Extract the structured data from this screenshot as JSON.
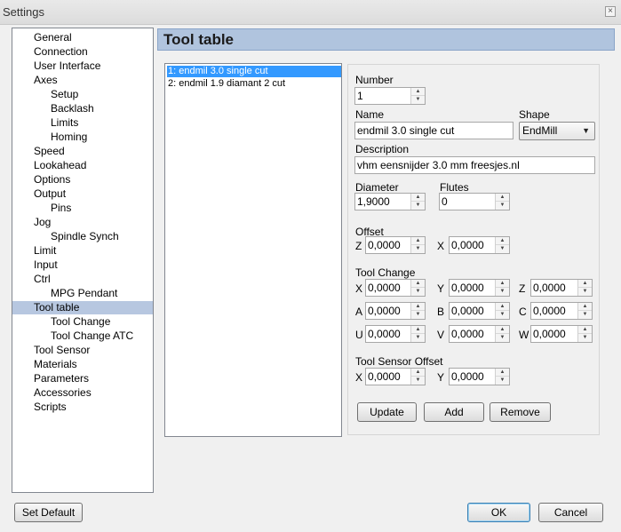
{
  "window": {
    "title": "Settings",
    "close_glyph": "×",
    "close_icon": "close-icon"
  },
  "nav": {
    "items": [
      {
        "label": "General",
        "level": 0,
        "selected": false
      },
      {
        "label": "Connection",
        "level": 0,
        "selected": false
      },
      {
        "label": "User Interface",
        "level": 0,
        "selected": false
      },
      {
        "label": "Axes",
        "level": 0,
        "selected": false
      },
      {
        "label": "Setup",
        "level": 1,
        "selected": false
      },
      {
        "label": "Backlash",
        "level": 1,
        "selected": false
      },
      {
        "label": "Limits",
        "level": 1,
        "selected": false
      },
      {
        "label": "Homing",
        "level": 1,
        "selected": false
      },
      {
        "label": "Speed",
        "level": 0,
        "selected": false
      },
      {
        "label": "Lookahead",
        "level": 0,
        "selected": false
      },
      {
        "label": "Options",
        "level": 0,
        "selected": false
      },
      {
        "label": "Output",
        "level": 0,
        "selected": false
      },
      {
        "label": "Pins",
        "level": 1,
        "selected": false
      },
      {
        "label": "Jog",
        "level": 0,
        "selected": false
      },
      {
        "label": "Spindle Synch",
        "level": 1,
        "selected": false
      },
      {
        "label": "Limit",
        "level": 0,
        "selected": false
      },
      {
        "label": "Input",
        "level": 0,
        "selected": false
      },
      {
        "label": "Ctrl",
        "level": 0,
        "selected": false
      },
      {
        "label": "MPG Pendant",
        "level": 1,
        "selected": false
      },
      {
        "label": "Tool table",
        "level": 0,
        "selected": true
      },
      {
        "label": "Tool Change",
        "level": 1,
        "selected": false
      },
      {
        "label": "Tool Change ATC",
        "level": 1,
        "selected": false
      },
      {
        "label": "Tool Sensor",
        "level": 0,
        "selected": false
      },
      {
        "label": "Materials",
        "level": 0,
        "selected": false
      },
      {
        "label": "Parameters",
        "level": 0,
        "selected": false
      },
      {
        "label": "Accessories",
        "level": 0,
        "selected": false
      },
      {
        "label": "Scripts",
        "level": 0,
        "selected": false
      }
    ]
  },
  "page": {
    "title": "Tool table"
  },
  "tools": [
    {
      "label": "1: endmil 3.0 single cut",
      "selected": true
    },
    {
      "label": "2: endmil 1.9 diamant 2 cut",
      "selected": false
    }
  ],
  "form": {
    "number_label": "Number",
    "number_value": "1",
    "name_label": "Name",
    "name_value": "endmil 3.0 single cut",
    "shape_label": "Shape",
    "shape_value": "EndMill",
    "shape_icon": "dropdown-arrow-icon",
    "description_label": "Description",
    "description_value": "vhm eensnijder 3.0 mm freesjes.nl",
    "diameter_label": "Diameter",
    "diameter_value": "1,9000",
    "flutes_label": "Flutes",
    "flutes_value": "0",
    "offset": {
      "label": "Offset",
      "z_label": "Z",
      "z_value": "0,0000",
      "x_label": "X",
      "x_value": "0,0000"
    },
    "tool_change": {
      "label": "Tool Change",
      "x_label": "X",
      "x_value": "0,0000",
      "y_label": "Y",
      "y_value": "0,0000",
      "z_label": "Z",
      "z_value": "0,0000",
      "a_label": "A",
      "a_value": "0,0000",
      "b_label": "B",
      "b_value": "0,0000",
      "c_label": "C",
      "c_value": "0,0000",
      "u_label": "U",
      "u_value": "0,0000",
      "v_label": "V",
      "v_value": "0,0000",
      "w_label": "W",
      "w_value": "0,0000"
    },
    "sensor_offset": {
      "label": "Tool Sensor Offset",
      "x_label": "X",
      "x_value": "0,0000",
      "y_label": "Y",
      "y_value": "0,0000"
    },
    "buttons": {
      "update": "Update",
      "add": "Add",
      "remove": "Remove"
    },
    "spin_up": "▲",
    "spin_down": "▼",
    "spin_icon": "spinner-arrows-icon"
  },
  "footer": {
    "set_default": "Set Default",
    "ok": "OK",
    "cancel": "Cancel"
  }
}
